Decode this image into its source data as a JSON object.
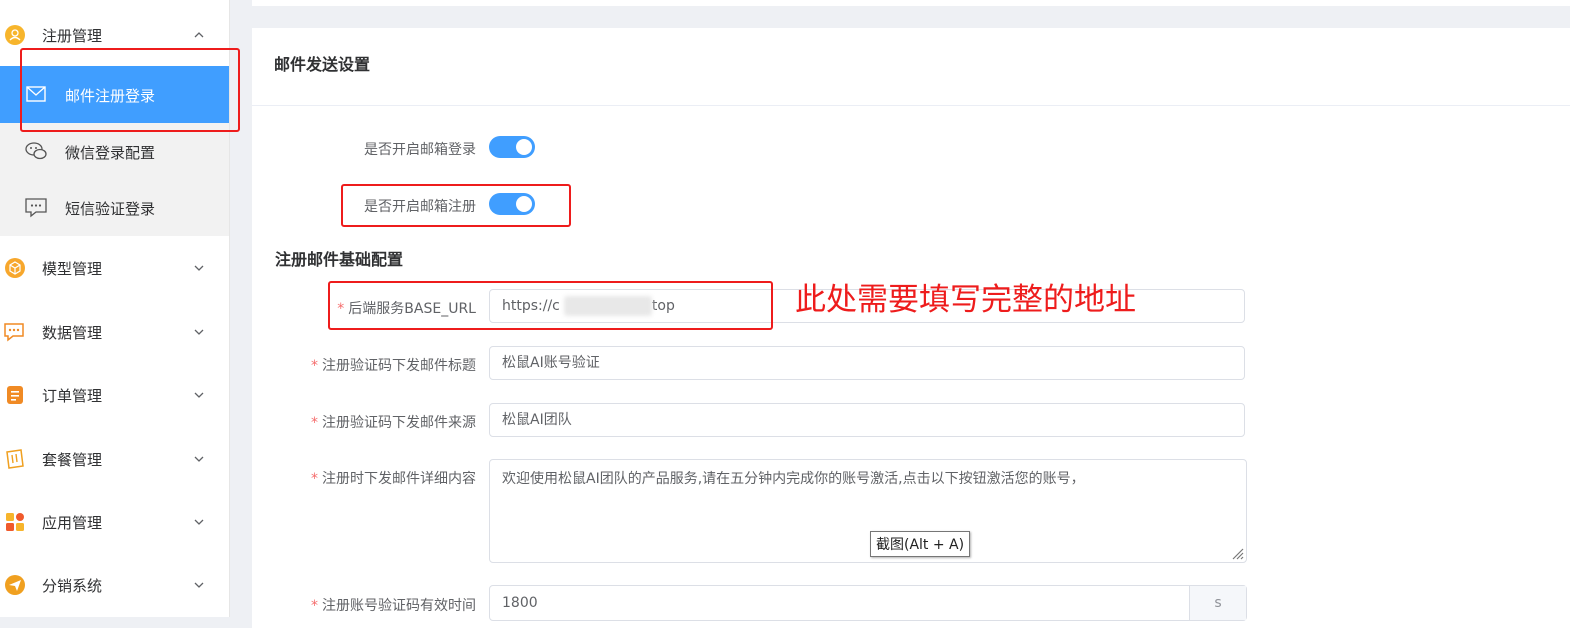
{
  "sidebar": {
    "groups": [
      {
        "label": "注册管理",
        "icon": "user-icon",
        "expanded": true
      },
      {
        "label": "模型管理",
        "icon": "cube-icon"
      },
      {
        "label": "数据管理",
        "icon": "chat-data-icon"
      },
      {
        "label": "订单管理",
        "icon": "order-icon"
      },
      {
        "label": "套餐管理",
        "icon": "package-icon"
      },
      {
        "label": "应用管理",
        "icon": "apps-icon"
      },
      {
        "label": "分销系统",
        "icon": "paper-plane-icon"
      }
    ],
    "subitems": [
      {
        "label": "邮件注册登录",
        "icon": "mail-icon",
        "active": true
      },
      {
        "label": "微信登录配置",
        "icon": "wechat-icon"
      },
      {
        "label": "短信验证登录",
        "icon": "sms-icon"
      }
    ]
  },
  "card": {
    "title": "邮件发送设置",
    "switches": [
      {
        "label": "是否开启邮箱登录",
        "on": true
      },
      {
        "label": "是否开启邮箱注册",
        "on": true
      }
    ],
    "section_title": "注册邮件基础配置",
    "fields": [
      {
        "label": "后端服务BASE_URL",
        "value": "https://c",
        "value_tail": "top",
        "required": true
      },
      {
        "label": "注册验证码下发邮件标题",
        "value": "松鼠AI账号验证",
        "required": true
      },
      {
        "label": "注册验证码下发邮件来源",
        "value": "松鼠AI团队",
        "required": true
      },
      {
        "label": "注册时下发邮件详细内容",
        "value": "欢迎使用松鼠AI团队的产品服务,请在五分钟内完成你的账号激活,点击以下按钮激活您的账号，",
        "required": true
      },
      {
        "label": "注册账号验证码有效时间",
        "value": "1800",
        "suffix": "s",
        "required": true
      }
    ]
  },
  "tooltip": "截图(Alt + A)",
  "annotation": "此处需要填写完整的地址",
  "colors": {
    "primary": "#409eff",
    "annotation": "#ee1c1c",
    "required": "#f56c6c"
  }
}
